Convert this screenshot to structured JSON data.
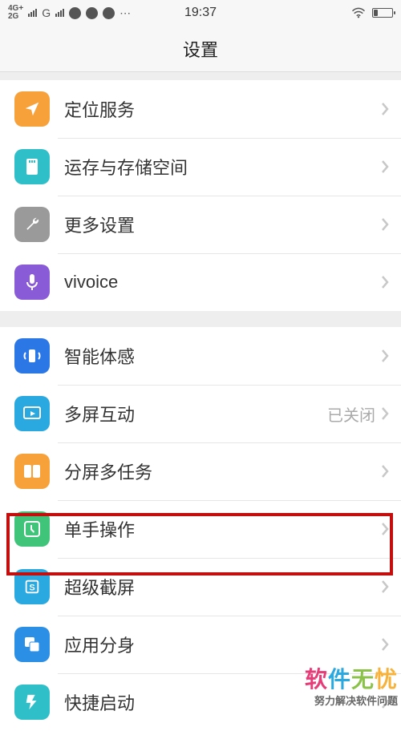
{
  "status": {
    "net4g": "4G+",
    "netG": "G",
    "time": "19:37"
  },
  "header": {
    "title": "设置"
  },
  "rows": {
    "location": "定位服务",
    "storage": "运存与存储空间",
    "more": "更多设置",
    "vivoice": "vivoice",
    "motion": "智能体感",
    "multiscreen": "多屏互动",
    "multiscreen_val": "已关闭",
    "split": "分屏多任务",
    "onehand": "单手操作",
    "supershot": "超级截屏",
    "appclone": "应用分身",
    "quicklaunch": "快捷启动"
  },
  "watermark": {
    "c1": "软",
    "c2": "件",
    "c3": "无",
    "c4": "忧",
    "sub": "努力解决软件问题"
  }
}
